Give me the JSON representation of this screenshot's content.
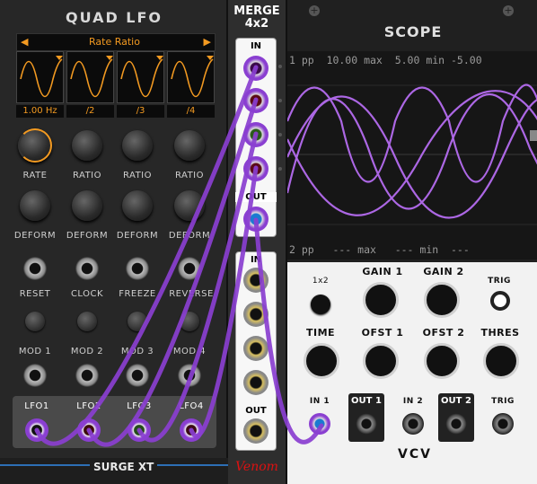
{
  "lfo": {
    "title": "QUAD LFO",
    "rate_selector": {
      "left_arrow": "◀",
      "label": "Rate Ratio",
      "right_arrow": "▶"
    },
    "waves": [
      "1.00 Hz",
      "/2",
      "/3",
      "/4"
    ],
    "rate_knobs": [
      "RATE",
      "RATIO",
      "RATIO",
      "RATIO"
    ],
    "deform_knobs": [
      "DEFORM",
      "DEFORM",
      "DEFORM",
      "DEFORM"
    ],
    "trigger_jacks": [
      "RESET",
      "CLOCK",
      "FREEZE",
      "REVERSE"
    ],
    "mod_buttons": [
      "MOD 1",
      "MOD 2",
      "MOD 3",
      "MOD 4"
    ],
    "outputs": [
      "LFO1",
      "LFO2",
      "LFO3",
      "LFO4"
    ],
    "brand": "SURGE XT",
    "accent": "#f39a21"
  },
  "merge": {
    "title_line1": "MERGE",
    "title_line2": "4x2",
    "in_label_1": "IN",
    "out_label_1": "OUT",
    "in_label_2": "IN",
    "out_label_2": "OUT",
    "brand": "Venom"
  },
  "scope": {
    "title": "SCOPE",
    "stats1": "1 pp  10.00 max  5.00 min -5.00",
    "stats2": "2 pp   --- max   --- min  ---",
    "mode_button": "1x2",
    "gain1": "GAIN 1",
    "gain2": "GAIN 2",
    "trig_button": "TRIG",
    "time": "TIME",
    "ofst1": "OFST 1",
    "ofst2": "OFST 2",
    "thres": "THRES",
    "in1": "IN 1",
    "out1": "OUT 1",
    "in2": "IN 2",
    "out2": "OUT 2",
    "trig_in": "TRIG",
    "brand": "VCV",
    "trace_color": "#b56cf0"
  },
  "cable_color": "#8a3fd1"
}
